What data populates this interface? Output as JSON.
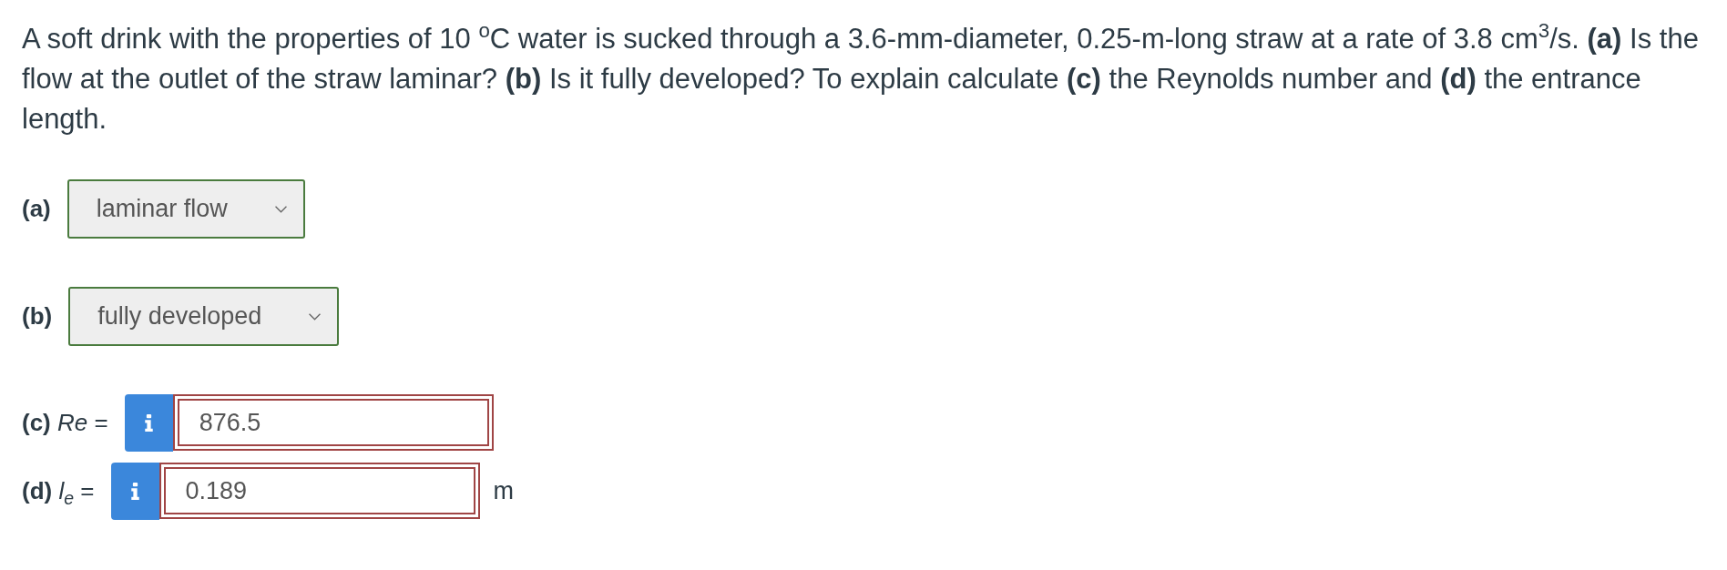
{
  "problem": {
    "text": "A soft drink with the properties of 10 $^{o}$C water is sucked through a 3.6-mm-diameter, 0.25-m-long straw at a rate of 3.8 cm$^{3}$/s. **(a)** Is the flow at the outlet of the straw laminar? **(b)** Is it fully developed? To explain calculate **(c)** the Reynolds number and **(d)** the entrance length."
  },
  "parts": [
    {
      "kind": "select",
      "label": "(a)",
      "value": "laminar flow",
      "correct": true
    },
    {
      "kind": "select",
      "label": "(b)",
      "value": "fully developed",
      "correct": true
    },
    {
      "kind": "numeric",
      "label": "**(c)** *Re* =",
      "value": "876.5",
      "correct": false
    },
    {
      "kind": "numeric",
      "label": "**(d)** *l*$_{e}$ =",
      "value": "0.189",
      "unit": "m",
      "correct": false
    }
  ]
}
